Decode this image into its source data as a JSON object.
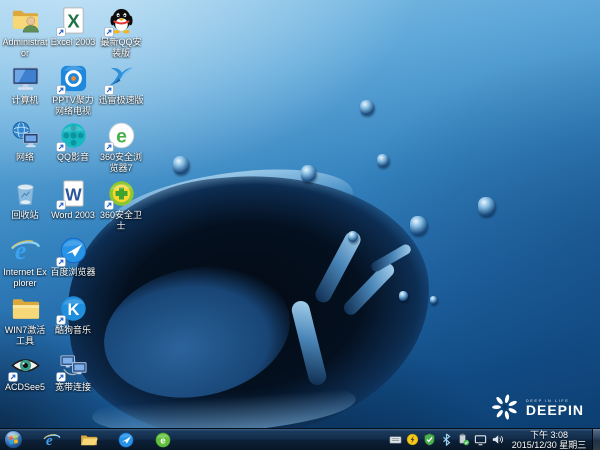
{
  "wallpaper": {
    "brand_small": "DEEP IN LIFE",
    "brand_large": "DEEPIN",
    "colors": {
      "sky_top": "#8ec8ea",
      "mid_blue": "#3381bd",
      "deep_blue": "#0a3a6b",
      "splash_dark": "#04101f"
    }
  },
  "desktop": {
    "columns": [
      {
        "items": [
          {
            "name": "administrator",
            "label": "Administrator",
            "icon": "folder-user-icon",
            "shortcut": false
          },
          {
            "name": "computer",
            "label": "计算机",
            "icon": "computer-icon",
            "shortcut": false
          },
          {
            "name": "network",
            "label": "网络",
            "icon": "network-globe-icon",
            "shortcut": false
          },
          {
            "name": "recycle-bin",
            "label": "回收站",
            "icon": "recycle-bin-icon",
            "shortcut": false
          },
          {
            "name": "internet-explorer",
            "label": "Internet Explorer",
            "icon": "ie-icon",
            "shortcut": false
          },
          {
            "name": "win7-activator",
            "label": "WIN7激活工具",
            "icon": "folder-icon",
            "shortcut": false
          },
          {
            "name": "acdsee5",
            "label": "ACDSee5",
            "icon": "eye-icon",
            "shortcut": true
          }
        ]
      },
      {
        "items": [
          {
            "name": "excel-2003",
            "label": "Excel 2003",
            "icon": "excel-icon",
            "shortcut": true
          },
          {
            "name": "pptv",
            "label": "PPTV聚力 网络电视",
            "icon": "pptv-icon",
            "shortcut": true
          },
          {
            "name": "qq-player",
            "label": "QQ影音",
            "icon": "film-reel-icon",
            "shortcut": true
          },
          {
            "name": "word-2003",
            "label": "Word 2003",
            "icon": "word-icon",
            "shortcut": true
          },
          {
            "name": "baidu-browser",
            "label": "百度浏览器",
            "icon": "baidu-browser-icon",
            "shortcut": true
          },
          {
            "name": "kugou-music",
            "label": "酷狗音乐",
            "icon": "kugou-icon",
            "shortcut": true
          },
          {
            "name": "broadband-connection",
            "label": "宽带连接",
            "icon": "broadband-icon",
            "shortcut": true
          }
        ]
      },
      {
        "items": [
          {
            "name": "qq-latest",
            "label": "最新QQ安装版",
            "icon": "qq-penguin-icon",
            "shortcut": true
          },
          {
            "name": "xunlei-speed",
            "label": "迅雷极速版",
            "icon": "xunlei-bird-icon",
            "shortcut": true
          },
          {
            "name": "360-browser-7",
            "label": "360安全浏览器7",
            "icon": "browser-360-icon",
            "shortcut": true
          },
          {
            "name": "360-safe-guard",
            "label": "360安全卫士",
            "icon": "safe-360-icon",
            "shortcut": true
          }
        ]
      }
    ]
  },
  "taskbar": {
    "buttons": [
      {
        "name": "internet-explorer",
        "icon": "ie-icon"
      },
      {
        "name": "windows-explorer",
        "icon": "explorer-folder-icon"
      },
      {
        "name": "baidu-browser",
        "icon": "baidu-browser-icon"
      },
      {
        "name": "360-browser",
        "icon": "browser-360-green-icon"
      }
    ],
    "tray_icons": [
      {
        "name": "input-method",
        "icon": "keyboard-icon"
      },
      {
        "name": "antivirus",
        "icon": "lightning-circle-icon"
      },
      {
        "name": "security-center",
        "icon": "shield-check-icon"
      },
      {
        "name": "bluetooth",
        "icon": "bluetooth-icon"
      },
      {
        "name": "removable-device",
        "icon": "usb-device-icon"
      },
      {
        "name": "display",
        "icon": "display-icon"
      },
      {
        "name": "volume",
        "icon": "speaker-icon"
      }
    ],
    "clock": {
      "time": "下午 3:08",
      "date": "2015/12/30 星期三"
    }
  }
}
